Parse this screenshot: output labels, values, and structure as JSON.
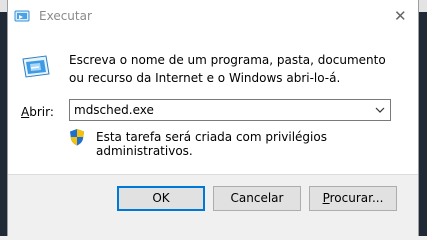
{
  "window": {
    "title": "Executar",
    "close_glyph": "✕"
  },
  "dialog": {
    "description": "Escreva o nome de um programa, pasta, documento ou recurso da Internet e o Windows abri-lo-á.",
    "open_label_accel": "A",
    "open_label_rest": "brir:",
    "open_value": "mdsched.exe",
    "admin_note": "Esta tarefa será criada com privilégios administrativos."
  },
  "buttons": {
    "ok": "OK",
    "cancel": "Cancelar",
    "browse_accel": "P",
    "browse_rest": "rocurar..."
  },
  "icons": {
    "title": "run-icon",
    "main": "run-icon",
    "shield": "uac-shield-icon",
    "dropdown": "chevron-down-icon",
    "close": "close-icon"
  },
  "colors": {
    "accent": "#0078d7",
    "shield_blue": "#1f6fd1",
    "shield_yellow": "#f4c20d"
  }
}
